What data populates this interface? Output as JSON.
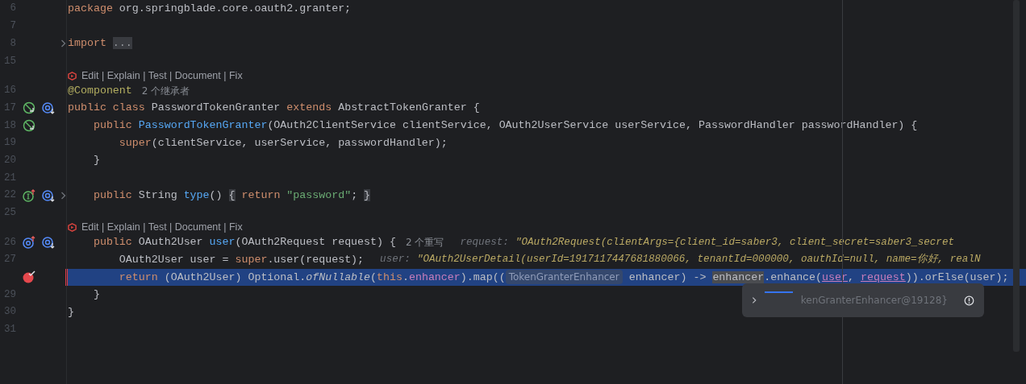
{
  "editor": {
    "lines": [
      {
        "kind": "code",
        "number": "6",
        "tokens": [
          {
            "kind": "kw",
            "text": "package"
          },
          {
            "kind": "plain",
            "text": " org.springblade.core.oauth2.granter;"
          }
        ]
      },
      {
        "kind": "code",
        "number": "7"
      },
      {
        "kind": "code",
        "number": "8",
        "fold": true,
        "tokens": [
          {
            "kind": "kw",
            "text": "import "
          },
          {
            "kind": "folded",
            "text": "..."
          }
        ]
      },
      {
        "kind": "code",
        "number": "15"
      },
      {
        "kind": "lens",
        "text": "Edit | Explain | Test | Document | Fix"
      },
      {
        "kind": "code",
        "number": "16",
        "tokens": [
          {
            "kind": "annotation",
            "text": "@Component"
          },
          {
            "kind": "hint",
            "text": "2 个继承者"
          }
        ]
      },
      {
        "kind": "code",
        "number": "17",
        "left_marker": {
          "kind": "implemented"
        },
        "right_marker": {
          "kind": "annotated"
        },
        "tokens": [
          {
            "kind": "kw",
            "text": "public class"
          },
          {
            "kind": "plain",
            "text": " PasswordTokenGranter "
          },
          {
            "kind": "kw",
            "text": "extends"
          },
          {
            "kind": "plain",
            "text": " AbstractTokenGranter {"
          }
        ]
      },
      {
        "kind": "code",
        "number": "18",
        "left_marker": {
          "kind": "implemented"
        },
        "tokens": [
          {
            "kind": "kw",
            "text": "    public "
          },
          {
            "kind": "fn",
            "text": "PasswordTokenGranter"
          },
          {
            "kind": "plain",
            "text": "(OAuth2ClientService clientService, OAuth2UserService userService, PasswordHandler passwordHandler) {"
          }
        ]
      },
      {
        "kind": "code",
        "number": "19",
        "tokens": [
          {
            "kind": "kw",
            "text": "        super"
          },
          {
            "kind": "plain",
            "text": "(clientService, userService, passwordHandler);"
          }
        ]
      },
      {
        "kind": "code",
        "number": "20",
        "tokens": [
          {
            "kind": "plain",
            "text": "    }"
          }
        ]
      },
      {
        "kind": "code",
        "number": "21"
      },
      {
        "kind": "code",
        "number": "22",
        "fold": true,
        "left_marker": {
          "kind": "interface-up"
        },
        "right_marker": {
          "kind": "annotated"
        },
        "tokens": [
          {
            "kind": "kw",
            "text": "    public"
          },
          {
            "kind": "plain",
            "text": " String "
          },
          {
            "kind": "fn",
            "text": "type"
          },
          {
            "kind": "plain",
            "text": "() "
          },
          {
            "kind": "brace",
            "text": "{"
          },
          {
            "kind": "kw",
            "text": " return "
          },
          {
            "kind": "str",
            "text": "\"password\""
          },
          {
            "kind": "plain",
            "text": "; "
          },
          {
            "kind": "brace",
            "text": "}"
          }
        ]
      },
      {
        "kind": "code",
        "number": "25"
      },
      {
        "kind": "lens",
        "text": "Edit | Explain | Test | Document | Fix"
      },
      {
        "kind": "code",
        "number": "26",
        "left_marker": {
          "kind": "override-up"
        },
        "right_marker": {
          "kind": "annotated"
        },
        "tokens": [
          {
            "kind": "kw",
            "text": "    public"
          },
          {
            "kind": "plain",
            "text": " OAuth2User "
          },
          {
            "kind": "fn",
            "text": "user"
          },
          {
            "kind": "plain",
            "text": "(OAuth2Request request) {"
          },
          {
            "kind": "hint",
            "text": "2 个重写"
          },
          {
            "kind": "dlabel",
            "text": "request:"
          },
          {
            "kind": "dvalue",
            "text": "\"OAuth2Request(clientArgs={client_id=saber3, client_secret=saber3_secret"
          }
        ]
      },
      {
        "kind": "code",
        "number": "27",
        "tokens": [
          {
            "kind": "plain",
            "text": "        OAuth2User user = "
          },
          {
            "kind": "kw",
            "text": "super"
          },
          {
            "kind": "plain",
            "text": ".user(request);"
          },
          {
            "kind": "dlabel",
            "text": "user:"
          },
          {
            "kind": "dvalue",
            "text": "\"OAuth2UserDetail(userId=1917117447681880066, tenantId=000000, oauthId=null, name=你好, realN"
          }
        ]
      },
      {
        "kind": "code",
        "highlighted": true,
        "left_marker": {
          "kind": "breakpoint"
        },
        "tokens": [
          {
            "kind": "kw",
            "text": "        return"
          },
          {
            "kind": "plain",
            "text": " (OAuth2User) Optional."
          },
          {
            "kind": "static",
            "text": "ofNullable"
          },
          {
            "kind": "plain",
            "text": "("
          },
          {
            "kind": "kw",
            "text": "this"
          },
          {
            "kind": "plain",
            "text": "."
          },
          {
            "kind": "field",
            "text": "enhancer"
          },
          {
            "kind": "plain",
            "text": ").map(("
          },
          {
            "kind": "chip",
            "text": "TokenGranterEnhancer"
          },
          {
            "kind": "plain",
            "text": " enhancer) -> "
          },
          {
            "kind": "match",
            "text": "enhancer"
          },
          {
            "kind": "plain",
            "text": ".enhance("
          },
          {
            "kind": "ref",
            "text": "user"
          },
          {
            "kind": "plain",
            "text": ", "
          },
          {
            "kind": "ref",
            "text": "request"
          },
          {
            "kind": "plain",
            "text": ")).orElse(user);"
          }
        ]
      },
      {
        "kind": "code",
        "number": "29",
        "tokens": [
          {
            "kind": "plain",
            "text": "    }"
          }
        ]
      },
      {
        "kind": "code",
        "number": "30",
        "tokens": [
          {
            "kind": "plain",
            "text": "}"
          }
        ]
      },
      {
        "kind": "code",
        "number": "31"
      }
    ]
  },
  "popup": {
    "text": "kenGranterEnhancer@19128}"
  }
}
